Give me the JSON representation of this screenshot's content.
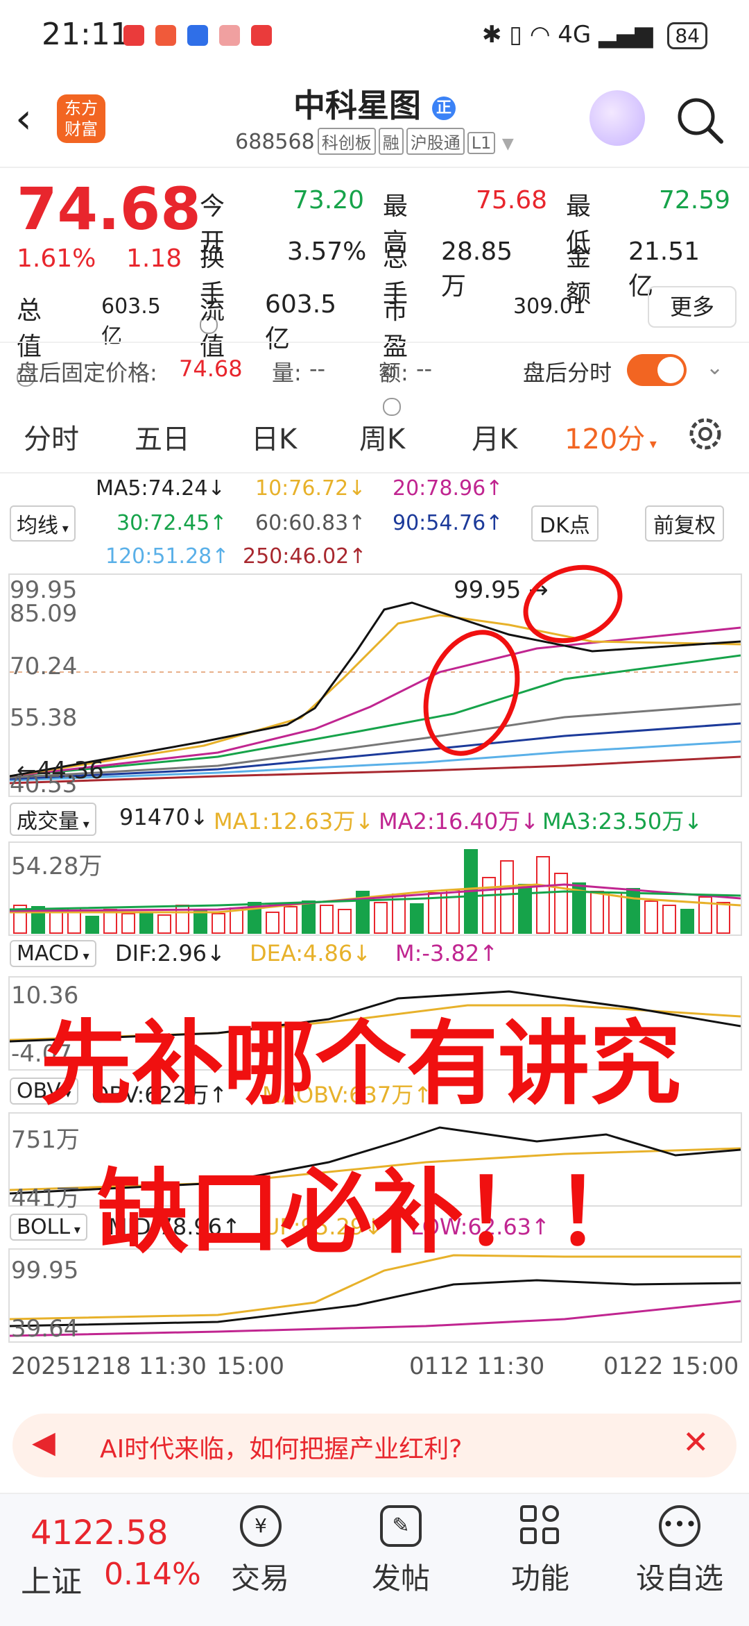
{
  "status": {
    "time": "21:11",
    "network": "4G",
    "battery": "84"
  },
  "header": {
    "logo_line1": "东方",
    "logo_line2": "财富",
    "title": "中科星图",
    "badge": "正",
    "code": "688568",
    "tags": [
      "科创板",
      "融",
      "沪股通",
      "L1"
    ]
  },
  "quote": {
    "price": "74.68",
    "change_pct": "1.61%",
    "change": "1.18",
    "open_label": "今开",
    "open": "73.20",
    "high_label": "最高",
    "high": "75.68",
    "low_label": "最低",
    "low": "72.59",
    "turnover_label": "换手",
    "turnover": "3.57%",
    "volume_label": "总手",
    "volume": "28.85万",
    "amount_label": "金额",
    "amount": "21.51亿",
    "mcap_label": "总值",
    "mcap": "603.5亿",
    "float_label": "流值",
    "float": "603.5亿",
    "pe_label": "市盈",
    "pe_sup": "动",
    "pe": "309.01",
    "more": "更多"
  },
  "afterhours": {
    "label": "盘后固定价格:",
    "price": "74.68",
    "vol_label": "量:",
    "vol": "--",
    "amt_label": "额:",
    "amt": "--",
    "toggle_label": "盘后分时"
  },
  "tabs": [
    "分时",
    "五日",
    "日K",
    "周K",
    "月K",
    "120分"
  ],
  "ma": {
    "selector": "均线",
    "ma5": "MA5:74.24↓",
    "ma10": "10:76.72↓",
    "ma20": "20:78.96↑",
    "ma30": "30:72.45↑",
    "ma60": "60:60.83↑",
    "ma90": "90:54.76↑",
    "ma120": "120:51.28↑",
    "ma250": "250:46.02↑",
    "dk": "DK点",
    "fq": "前复权"
  },
  "kline": {
    "y_labels": [
      "99.95",
      "85.09",
      "70.24",
      "55.38",
      "40.53"
    ],
    "high_mark": "99.95",
    "low_mark": "44.36"
  },
  "volume": {
    "selector": "成交量",
    "value": "91470↓",
    "ma1": "MA1:12.63万↓",
    "ma2": "MA2:16.40万↓",
    "ma3": "MA3:23.50万↓",
    "y_label": "54.28万"
  },
  "macd": {
    "selector": "MACD",
    "dif": "DIF:2.96↓",
    "dea": "DEA:4.86↓",
    "m": "M:-3.82↑",
    "y_top": "10.36",
    "y_bot": "-4.07"
  },
  "obv": {
    "selector": "OBV",
    "obv": "OBV:622万↑",
    "maobv": "MAOBV:637万↑",
    "y_top": "751万",
    "y_bot": "441万"
  },
  "boll": {
    "selector": "BOLL",
    "mid": "MID:78.96↑",
    "up": "UP:95.29↓",
    "low": "LOW:62.63↑",
    "y_top": "99.95",
    "y_bot": "39.64"
  },
  "xaxis": [
    "20251218 11:30",
    "15:00",
    "0112 11:30",
    "0122 15:00"
  ],
  "overlay": {
    "line1": "先补哪个有讲究",
    "line2": "缺口必补！！"
  },
  "banner": {
    "text": "AI时代来临，如何把握产业红利?"
  },
  "bottom": {
    "index_value": "4122.58",
    "index_name": "上证",
    "index_change": "0.14%",
    "items": [
      "交易",
      "发帖",
      "功能",
      "设自选"
    ]
  },
  "colors": {
    "up": "#e8262d",
    "down": "#16a34a",
    "accent": "#f26522"
  }
}
